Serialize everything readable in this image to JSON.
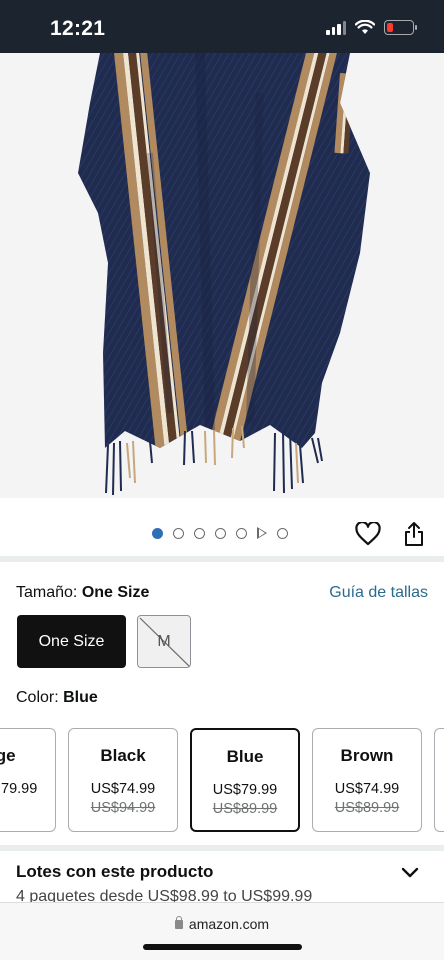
{
  "status_bar": {
    "time": "12:21",
    "battery_level": 0.2
  },
  "product_image": {
    "alt_subject": "poncho",
    "colors": {
      "navy": "#1f2b4f",
      "stripe_tan": "#b18a5f",
      "stripe_brown": "#5a3c28",
      "stripe_cream": "#efe4cf"
    }
  },
  "carousel": {
    "image_dots": 5,
    "active_index": 0,
    "has_video": true,
    "icons": [
      "heart-icon",
      "share-icon"
    ]
  },
  "size": {
    "label": "Tamaño: ",
    "selected": "One Size",
    "guide_link": "Guía de tallas",
    "options": [
      {
        "label": "One Size",
        "state": "selected"
      },
      {
        "label": "M",
        "state": "unavailable"
      }
    ]
  },
  "color": {
    "label": "Color: ",
    "selected": "Blue"
  },
  "swatches": [
    {
      "name": "ige",
      "price": "79.99",
      "list_price": ""
    },
    {
      "name": "Black",
      "price": "US$74.99",
      "list_price": "US$94.99"
    },
    {
      "name": "Blue",
      "price": "US$79.99",
      "list_price": "US$89.99"
    },
    {
      "name": "Brown",
      "price": "US$74.99",
      "list_price": "US$89.99"
    }
  ],
  "bundles": {
    "title": "Lotes con este producto",
    "subtitle": "4 paquetes desde US$98.99 to US$99.99"
  },
  "browser": {
    "url": "amazon.com"
  },
  "colors": {
    "accent_link": "#2a6a8e",
    "active_dot": "#2f6fb7",
    "status_bar_bg": "#1c2430"
  }
}
